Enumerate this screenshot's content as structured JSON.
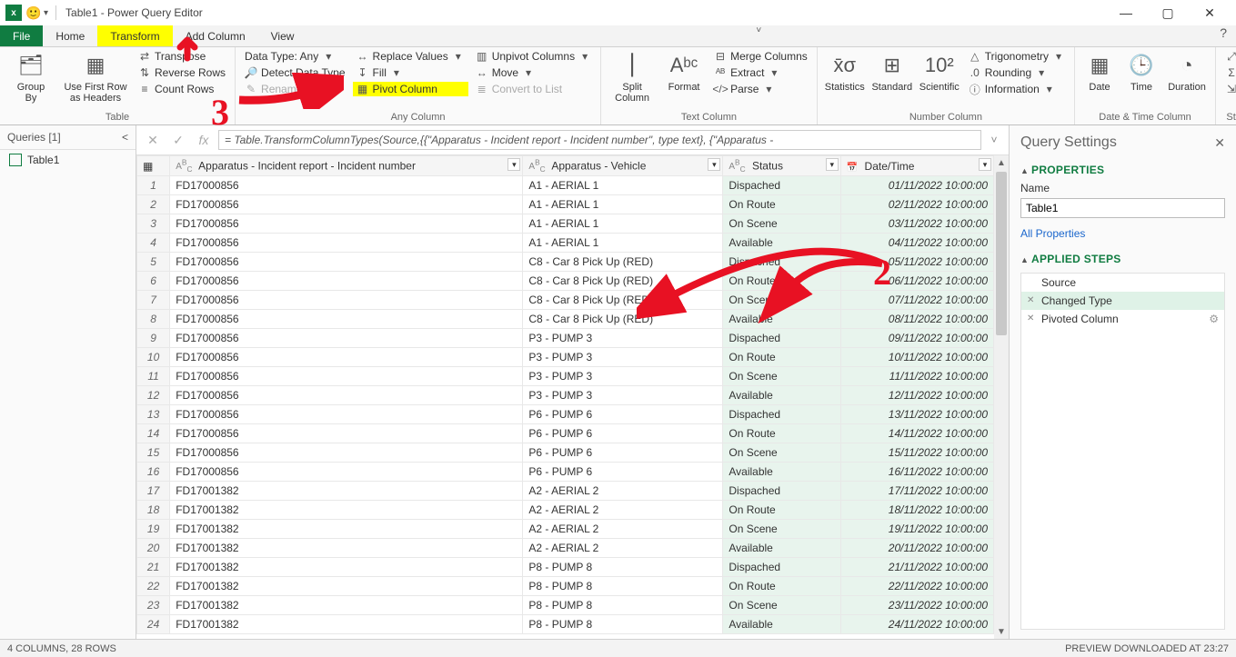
{
  "window": {
    "title": "Table1 - Power Query Editor"
  },
  "tabs": {
    "file": "File",
    "home": "Home",
    "transform": "Transform",
    "addcol": "Add Column",
    "view": "View"
  },
  "ribbon": {
    "table": {
      "groupby": "Group\nBy",
      "headers": "Use First Row\nas Headers",
      "transpose": "Transpose",
      "reverse": "Reverse Rows",
      "count": "Count Rows",
      "label": "Table"
    },
    "anycol": {
      "datatype": "Data Type: Any",
      "detect": "Detect Data Type",
      "rename": "Rename",
      "replace": "Replace Values",
      "fill": "Fill",
      "pivot": "Pivot Column",
      "unpivot": "Unpivot Columns",
      "move": "Move",
      "convert": "Convert to List",
      "label": "Any Column"
    },
    "textcol": {
      "split": "Split\nColumn",
      "format": "Format",
      "merge": "Merge Columns",
      "extract": "Extract",
      "parse": "Parse",
      "label": "Text Column"
    },
    "numcol": {
      "stats": "Statistics",
      "standard": "Standard",
      "scientific": "Scientific",
      "trig": "Trigonometry",
      "round": "Rounding",
      "info": "Information",
      "label": "Number Column"
    },
    "datecol": {
      "date": "Date",
      "time": "Time",
      "duration": "Duration",
      "label": "Date & Time Column"
    },
    "structcol": {
      "expand": "Expand",
      "aggregate": "Aggregate",
      "extract": "Extract Values",
      "label": "Structured Column"
    }
  },
  "queries": {
    "header": "Queries [1]",
    "items": [
      "Table1"
    ]
  },
  "formula": "= Table.TransformColumnTypes(Source,{{\"Apparatus - Incident report - Incident number\", type text}, {\"Apparatus -",
  "columns": [
    {
      "name": "Apparatus - Incident report - Incident number",
      "type": "ABC"
    },
    {
      "name": "Apparatus - Vehicle",
      "type": "ABC"
    },
    {
      "name": "Status",
      "type": "ABC"
    },
    {
      "name": "Date/Time",
      "type": "📅"
    }
  ],
  "rows": [
    [
      "FD17000856",
      "A1 - AERIAL 1",
      "Dispached",
      "01/11/2022 10:00:00"
    ],
    [
      "FD17000856",
      "A1 - AERIAL 1",
      "On Route",
      "02/11/2022 10:00:00"
    ],
    [
      "FD17000856",
      "A1 - AERIAL 1",
      "On Scene",
      "03/11/2022 10:00:00"
    ],
    [
      "FD17000856",
      "A1 - AERIAL 1",
      "Available",
      "04/11/2022 10:00:00"
    ],
    [
      "FD17000856",
      "C8 - Car 8 Pick Up (RED)",
      "Dispached",
      "05/11/2022 10:00:00"
    ],
    [
      "FD17000856",
      "C8 - Car 8 Pick Up (RED)",
      "On Route",
      "06/11/2022 10:00:00"
    ],
    [
      "FD17000856",
      "C8 - Car 8 Pick Up (RED)",
      "On Scene",
      "07/11/2022 10:00:00"
    ],
    [
      "FD17000856",
      "C8 - Car 8 Pick Up (RED)",
      "Available",
      "08/11/2022 10:00:00"
    ],
    [
      "FD17000856",
      "P3 - PUMP 3",
      "Dispached",
      "09/11/2022 10:00:00"
    ],
    [
      "FD17000856",
      "P3 - PUMP 3",
      "On Route",
      "10/11/2022 10:00:00"
    ],
    [
      "FD17000856",
      "P3 - PUMP 3",
      "On Scene",
      "11/11/2022 10:00:00"
    ],
    [
      "FD17000856",
      "P3 - PUMP 3",
      "Available",
      "12/11/2022 10:00:00"
    ],
    [
      "FD17000856",
      "P6 - PUMP 6",
      "Dispached",
      "13/11/2022 10:00:00"
    ],
    [
      "FD17000856",
      "P6 - PUMP 6",
      "On Route",
      "14/11/2022 10:00:00"
    ],
    [
      "FD17000856",
      "P6 - PUMP 6",
      "On Scene",
      "15/11/2022 10:00:00"
    ],
    [
      "FD17000856",
      "P6 - PUMP 6",
      "Available",
      "16/11/2022 10:00:00"
    ],
    [
      "FD17001382",
      "A2 - AERIAL 2",
      "Dispached",
      "17/11/2022 10:00:00"
    ],
    [
      "FD17001382",
      "A2 - AERIAL 2",
      "On Route",
      "18/11/2022 10:00:00"
    ],
    [
      "FD17001382",
      "A2 - AERIAL 2",
      "On Scene",
      "19/11/2022 10:00:00"
    ],
    [
      "FD17001382",
      "A2 - AERIAL 2",
      "Available",
      "20/11/2022 10:00:00"
    ],
    [
      "FD17001382",
      "P8 - PUMP 8",
      "Dispached",
      "21/11/2022 10:00:00"
    ],
    [
      "FD17001382",
      "P8 - PUMP 8",
      "On Route",
      "22/11/2022 10:00:00"
    ],
    [
      "FD17001382",
      "P8 - PUMP 8",
      "On Scene",
      "23/11/2022 10:00:00"
    ],
    [
      "FD17001382",
      "P8 - PUMP 8",
      "Available",
      "24/11/2022 10:00:00"
    ]
  ],
  "settings": {
    "title": "Query Settings",
    "properties": "PROPERTIES",
    "name_lbl": "Name",
    "name_val": "Table1",
    "allprops": "All Properties",
    "applied": "APPLIED STEPS",
    "steps": [
      "Source",
      "Changed Type",
      "Pivoted Column"
    ],
    "selected_step": 1
  },
  "status": {
    "left": "4 COLUMNS, 28 ROWS",
    "right": "PREVIEW DOWNLOADED AT 23:27"
  },
  "annotations": {
    "n2": "2",
    "n3": "3"
  }
}
